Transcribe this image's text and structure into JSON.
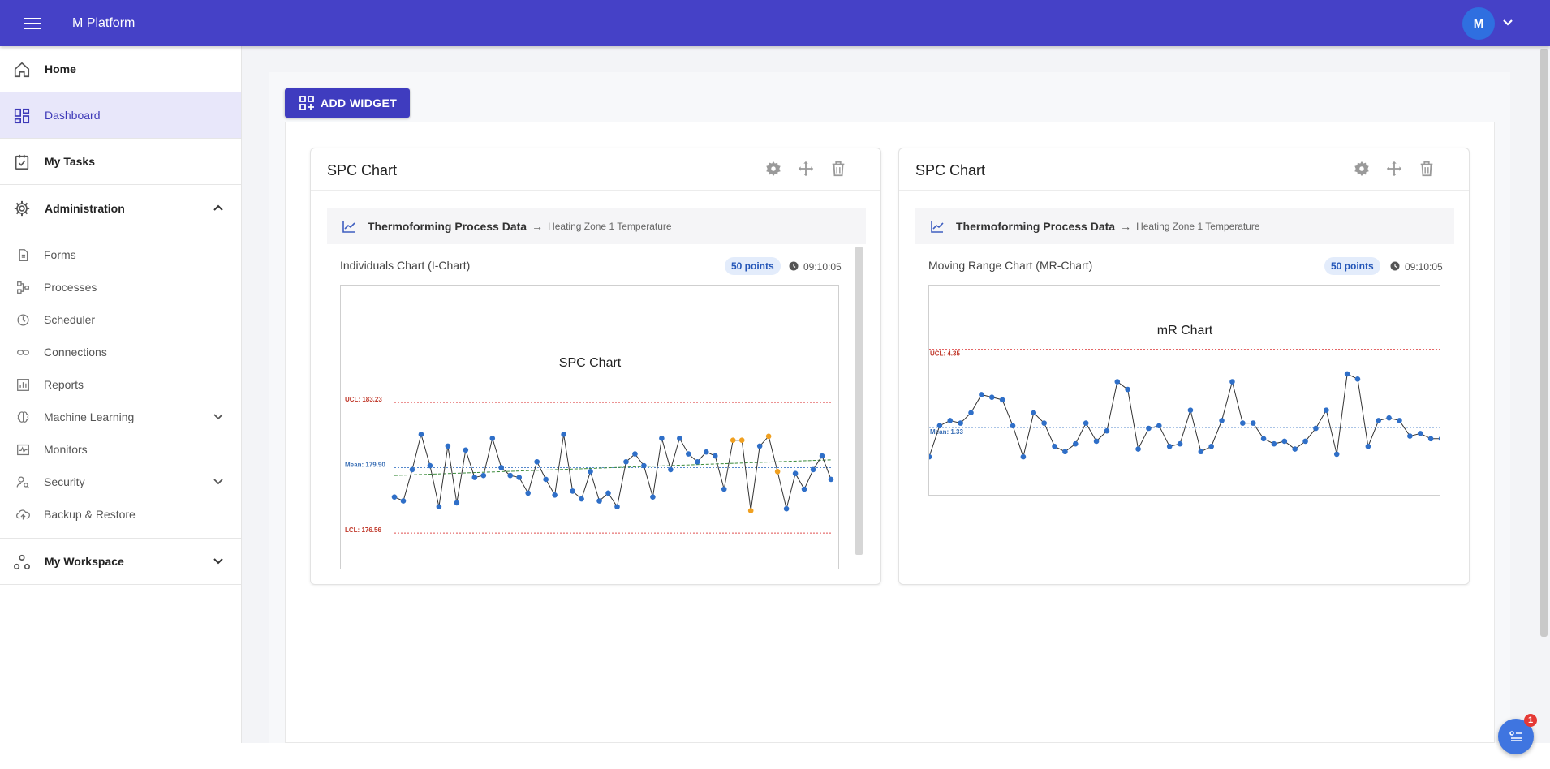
{
  "app": {
    "title": "M Platform",
    "user_initial": "M"
  },
  "icons": {
    "menu": "hamburger-icon",
    "home": "home-icon",
    "dashboard": "dashboard-icon",
    "tasks": "task-check-icon",
    "admin": "gear-icon",
    "workspace": "workspace-icon",
    "settings": "gear-icon",
    "move": "move-icon",
    "delete": "trash-icon",
    "chart": "line-chart-icon",
    "clock": "clock-icon"
  },
  "colors": {
    "topbar": "#4541c7",
    "accent": "#3f3cbf",
    "point": "#2f6fc8",
    "violation": "#f0a020",
    "limit": "#e05050",
    "mean": "#5588cc",
    "trend": "#3a8a3a"
  },
  "sidebar": {
    "home": "Home",
    "dashboard": "Dashboard",
    "my_tasks": "My Tasks",
    "administration": "Administration",
    "admin_items": [
      "Forms",
      "Processes",
      "Scheduler",
      "Connections",
      "Reports",
      "Machine Learning",
      "Monitors",
      "Security",
      "Backup & Restore"
    ],
    "my_workspace": "My Workspace"
  },
  "toolbar": {
    "add_widget": "ADD WIDGET"
  },
  "widgets": [
    {
      "title": "SPC Chart",
      "source": "Thermoforming Process Data",
      "arrow": "→",
      "field": "Heating Zone 1 Temperature",
      "chart_name": "Individuals Chart (I-Chart)",
      "points_badge": "50 points",
      "time": "09:10:05"
    },
    {
      "title": "SPC Chart",
      "source": "Thermoforming Process Data",
      "arrow": "→",
      "field": "Heating Zone 1 Temperature",
      "chart_name": "Moving Range Chart (MR-Chart)",
      "points_badge": "50 points",
      "time": "09:10:05"
    }
  ],
  "notifications": {
    "count": "1"
  },
  "chart_data": [
    {
      "type": "line",
      "title": "SPC Chart",
      "ucl_label": "UCL: 183.23",
      "mean_label": "Mean: 179.90",
      "lcl_label": "LCL: 176.56",
      "ucl": 183.23,
      "mean": 179.9,
      "lcl": 176.56,
      "ylim": [
        174.7,
        189.2
      ],
      "trend_line": [
        179.5,
        180.3
      ],
      "x": [
        1,
        2,
        3,
        4,
        5,
        6,
        7,
        8,
        9,
        10,
        11,
        12,
        13,
        14,
        15,
        16,
        17,
        18,
        19,
        20,
        21,
        22,
        23,
        24,
        25,
        26,
        27,
        28,
        29,
        30,
        31,
        32,
        33,
        34,
        35,
        36,
        37,
        38,
        39,
        40,
        41,
        42,
        43,
        44,
        45,
        46,
        47,
        48,
        49,
        50
      ],
      "values": [
        178.4,
        178.2,
        179.8,
        181.6,
        180.0,
        177.9,
        181.0,
        178.1,
        180.8,
        179.4,
        179.5,
        181.4,
        179.9,
        179.5,
        179.4,
        178.6,
        180.2,
        179.3,
        178.5,
        181.6,
        178.7,
        178.3,
        179.7,
        178.2,
        178.6,
        177.9,
        180.2,
        180.6,
        180.0,
        178.4,
        181.4,
        179.8,
        181.4,
        180.6,
        180.2,
        180.7,
        180.5,
        178.8,
        181.3,
        181.3,
        177.7,
        181.0,
        181.5,
        179.7,
        177.8,
        179.6,
        178.8,
        179.8,
        180.5,
        179.3
      ],
      "violations": [
        39,
        40,
        41,
        43,
        44
      ],
      "violation_values": [
        181.3,
        181.3,
        177.7,
        181.0,
        181.5
      ]
    },
    {
      "type": "line",
      "title": "mR Chart",
      "ucl_label": "UCL: 4.35",
      "mean_label": "Mean: 1.33",
      "ucl": 4.35,
      "mean": 1.33,
      "ylim": [
        -1.33,
        6.81
      ],
      "x": [
        1,
        2,
        3,
        4,
        5,
        6,
        7,
        8,
        9,
        10,
        11,
        12,
        13,
        14,
        15,
        16,
        17,
        18,
        19,
        20,
        21,
        22,
        23,
        24,
        25,
        26,
        27,
        28,
        29,
        30,
        31,
        32,
        33,
        34,
        35,
        36,
        37,
        38,
        39,
        40,
        41,
        42,
        43,
        44,
        45,
        46,
        47,
        48,
        49,
        50
      ],
      "values": [
        0.2,
        1.4,
        1.6,
        1.5,
        1.9,
        2.6,
        2.5,
        2.4,
        1.4,
        0.2,
        1.9,
        1.5,
        0.6,
        0.4,
        0.7,
        1.5,
        0.8,
        1.2,
        3.1,
        2.8,
        0.5,
        1.3,
        1.4,
        0.6,
        0.7,
        2.0,
        0.4,
        0.6,
        1.6,
        3.1,
        1.5,
        1.5,
        0.9,
        0.7,
        0.8,
        0.5,
        0.8,
        1.3,
        2.0,
        0.3,
        3.4,
        3.2,
        0.6,
        1.6,
        1.7,
        1.6,
        1.0,
        1.1,
        0.9,
        0.9
      ]
    }
  ]
}
